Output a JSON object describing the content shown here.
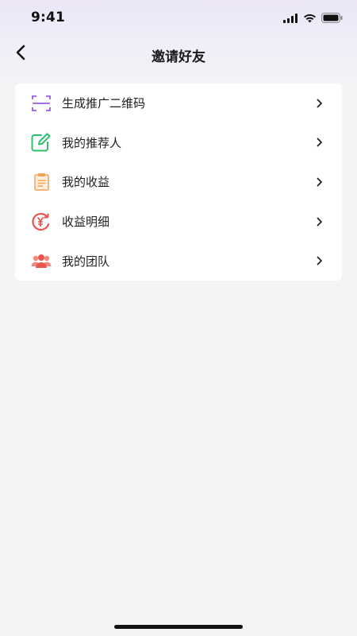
{
  "status_bar": {
    "time": "9:41"
  },
  "nav": {
    "title": "邀请好友",
    "back_icon": "chevron-left-icon"
  },
  "menu": {
    "items": [
      {
        "label": "生成推广二维码",
        "icon": "scan-frame-icon",
        "color": "#9b5cd6"
      },
      {
        "label": "我的推荐人",
        "icon": "edit-icon",
        "color": "#2fbf6b"
      },
      {
        "label": "我的收益",
        "icon": "document-icon",
        "color": "#f0a25a"
      },
      {
        "label": "收益明细",
        "icon": "yuan-refresh-icon",
        "color": "#e8574f"
      },
      {
        "label": "我的团队",
        "icon": "team-icon",
        "color": "#ee6b5e"
      }
    ]
  },
  "colors": {
    "background": "#f4f4f5",
    "card": "#ffffff",
    "header_gradient_top": "#ebe6f6"
  }
}
